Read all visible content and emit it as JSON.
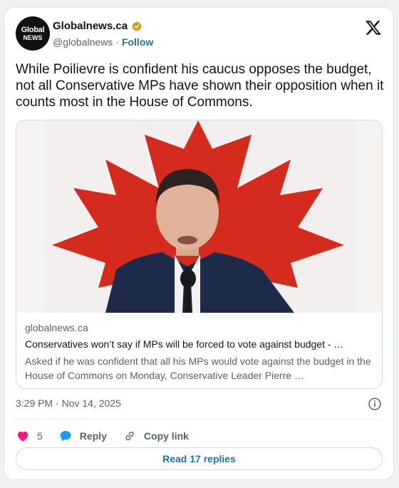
{
  "author": {
    "avatar_line1": "Global",
    "avatar_line2": "NEWS",
    "name": "Globalnews.ca",
    "handle": "@globalnews",
    "separator": "·",
    "follow_label": "Follow",
    "verified_color": "#c9a227"
  },
  "tweet": {
    "text": "While Poilievre is confident his caucus opposes the budget, not all Conservative MPs have shown their opposition when it counts most in the House of Commons."
  },
  "link_card": {
    "domain": "globalnews.ca",
    "headline": "Conservatives won’t say if MPs will be forced to vote against budget - …",
    "description": "Asked if he was confident that all his MPs would vote against the budget in the House of Commons on Monday, Conservative Leader Pierre …",
    "image_icon": "canada-flag-speaker-photo"
  },
  "meta": {
    "timestamp": "3:29 PM · Nov 14, 2025"
  },
  "actions": {
    "like_count": "5",
    "reply_label": "Reply",
    "copy_label": "Copy link",
    "read_replies_label": "Read 17 replies"
  },
  "colors": {
    "accent": "#1d73a8",
    "like": "#f91880",
    "reply": "#1d9bf0",
    "flag_red": "#d52b1e"
  }
}
